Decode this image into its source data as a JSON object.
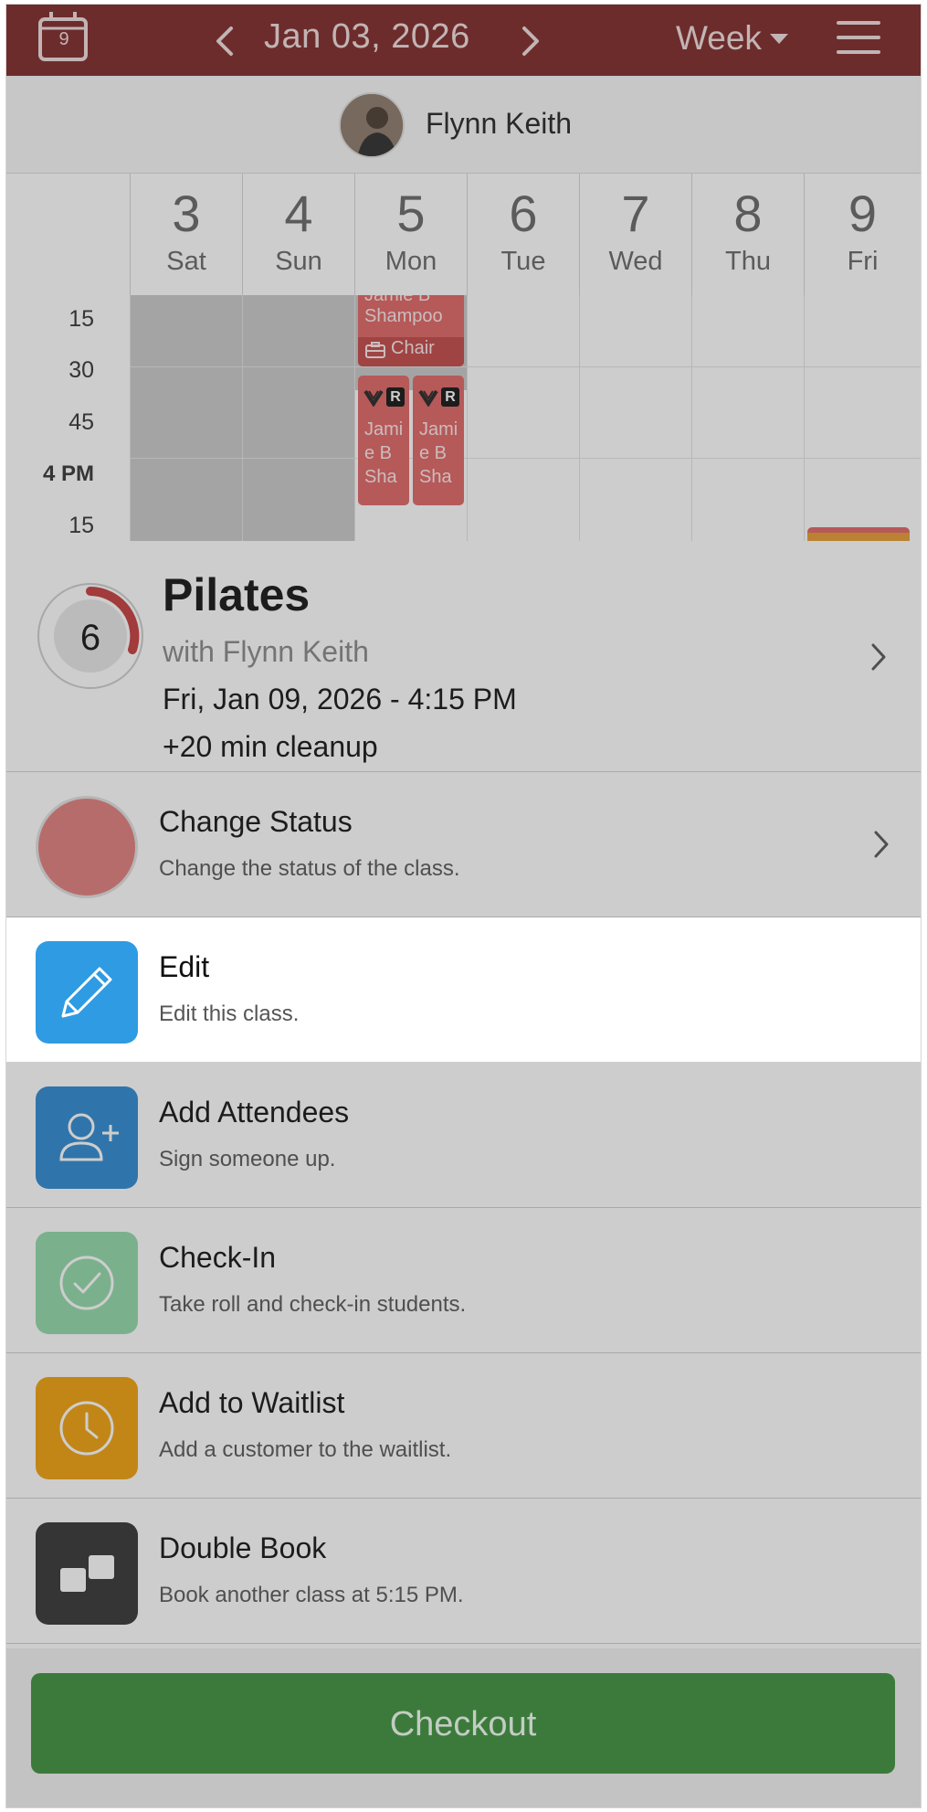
{
  "header": {
    "calendar_day": "9",
    "date": "Jan 03, 2026",
    "view": "Week",
    "color": "#7e2727"
  },
  "staff": {
    "name": "Flynn Keith"
  },
  "days": [
    {
      "num": "3",
      "name": "Sat"
    },
    {
      "num": "4",
      "name": "Sun"
    },
    {
      "num": "5",
      "name": "Mon"
    },
    {
      "num": "6",
      "name": "Tue"
    },
    {
      "num": "7",
      "name": "Wed"
    },
    {
      "num": "8",
      "name": "Thu"
    },
    {
      "num": "9",
      "name": "Fri"
    }
  ],
  "times": [
    "15",
    "30",
    "45",
    "4 PM",
    "15"
  ],
  "appointments": {
    "a1_lines": [
      "Jamie B",
      "Shampoo"
    ],
    "a1_resource": "Chair",
    "a2_lines": [
      "Jami",
      "e B",
      "Sha"
    ],
    "a3_lines": [
      "Jami",
      "e B",
      "Sha"
    ],
    "badge": "R"
  },
  "class_summary": {
    "capacity": "6",
    "name": "Pilates",
    "instructor": "with Flynn Keith",
    "datetime": "Fri, Jan 09, 2026 - 4:15 PM",
    "cleanup": "+20 min cleanup"
  },
  "actions": [
    {
      "title": "Change Status",
      "subtitle": "Change the status of the class.",
      "icon": "status-dot",
      "color": "#e27d7d"
    },
    {
      "title": "Edit",
      "subtitle": "Edit this class.",
      "icon": "pencil-icon",
      "color": "#2f9be2"
    },
    {
      "title": "Add Attendees",
      "subtitle": "Sign someone up.",
      "icon": "add-user-icon",
      "color": "#2a89d1"
    },
    {
      "title": "Check-In",
      "subtitle": "Take roll and check-in students.",
      "icon": "check-circle-icon",
      "color": "#8fd9a8"
    },
    {
      "title": "Add to Waitlist",
      "subtitle": "Add a customer to the waitlist.",
      "icon": "clock-icon",
      "color": "#f0a00a"
    },
    {
      "title": "Double Book",
      "subtitle": "Book another class at 5:15 PM.",
      "icon": "double-book-icon",
      "color": "#333333"
    }
  ],
  "checkout": {
    "label": "Checkout",
    "color": "#3c8f3c"
  }
}
